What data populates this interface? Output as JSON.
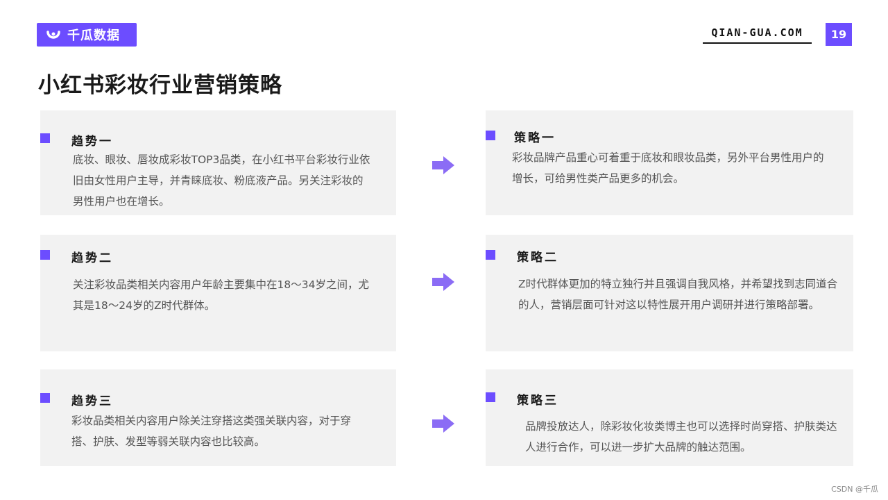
{
  "header": {
    "brand": "千瓜数据",
    "site": "QIAN-GUA.COM",
    "page_number": "19"
  },
  "title": "小红书彩妆行业营销策略",
  "trends": [
    {
      "label": "趋势一",
      "text": "底妆、眼妆、唇妆成彩妆TOP3品类，在小红书平台彩妆行业依旧由女性用户主导，并青睐底妆、粉底液产品。另关注彩妆的男性用户也在增长。"
    },
    {
      "label": "趋势二",
      "text": "关注彩妆品类相关内容用户年龄主要集中在18～34岁之间，尤其是18～24岁的Z时代群体。"
    },
    {
      "label": "趋势三",
      "text": "彩妆品类相关内容用户除关注穿搭这类强关联内容，对于穿搭、护肤、发型等弱关联内容也比较高。"
    }
  ],
  "strategies": [
    {
      "label": "策略一",
      "text": "彩妆品牌产品重心可着重于底妆和眼妆品类，另外平台男性用户的增长，可给男性类产品更多的机会。"
    },
    {
      "label": "策略二",
      "text": "Z时代群体更加的特立独行并且强调自我风格，并希望找到志同道合的人，营销层面可针对这以特性展开用户调研并进行策略部署。"
    },
    {
      "label": "策略三",
      "text": "品牌投放达人，除彩妆化妆类博主也可以选择时尚穿搭、护肤类达人进行合作，可以进一步扩大品牌的触达范围。"
    }
  ],
  "footer": {
    "credit": "CSDN @千瓜"
  },
  "colors": {
    "accent": "#6c4dff",
    "arrow": "#8b6cf5",
    "card_bg": "#f2f2f2"
  }
}
